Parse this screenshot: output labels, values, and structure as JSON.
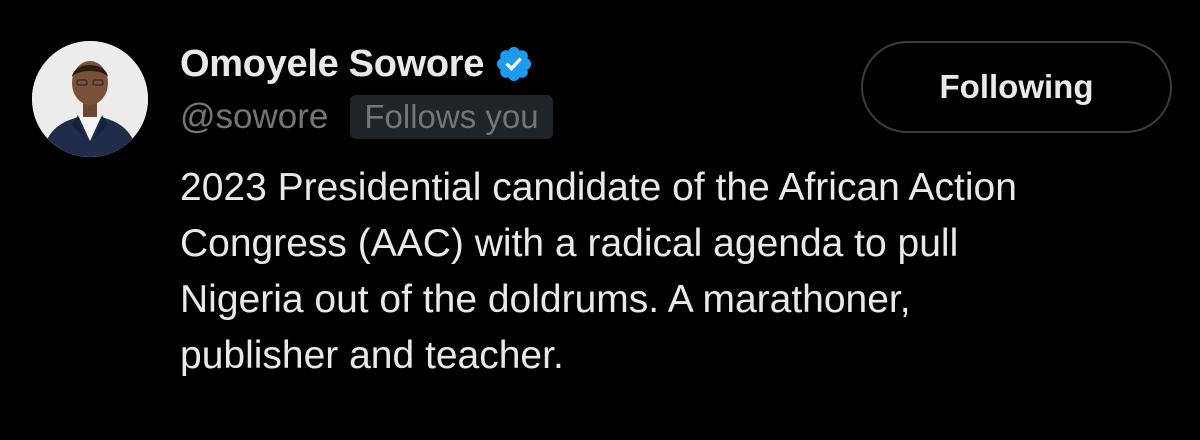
{
  "profile": {
    "display_name": "Omoyele Sowore",
    "handle": "@sowore",
    "follows_badge": "Follows you",
    "verified": true,
    "avatar": "profile-photo-man-in-suit"
  },
  "actions": {
    "following_label": "Following"
  },
  "bio": {
    "lines": [
      "2023 Presidential candidate of the African Action",
      "Congress (AAC) with a radical agenda to pull",
      "Nigeria out of the doldrums. A marathoner,",
      "publisher and teacher."
    ]
  },
  "colors": {
    "background": "#000000",
    "primary_text": "#e7e9ea",
    "secondary_text": "#71767b",
    "badge_background": "#202327",
    "button_border": "#3a3e42",
    "verified_blue": "#1d9bf0"
  }
}
